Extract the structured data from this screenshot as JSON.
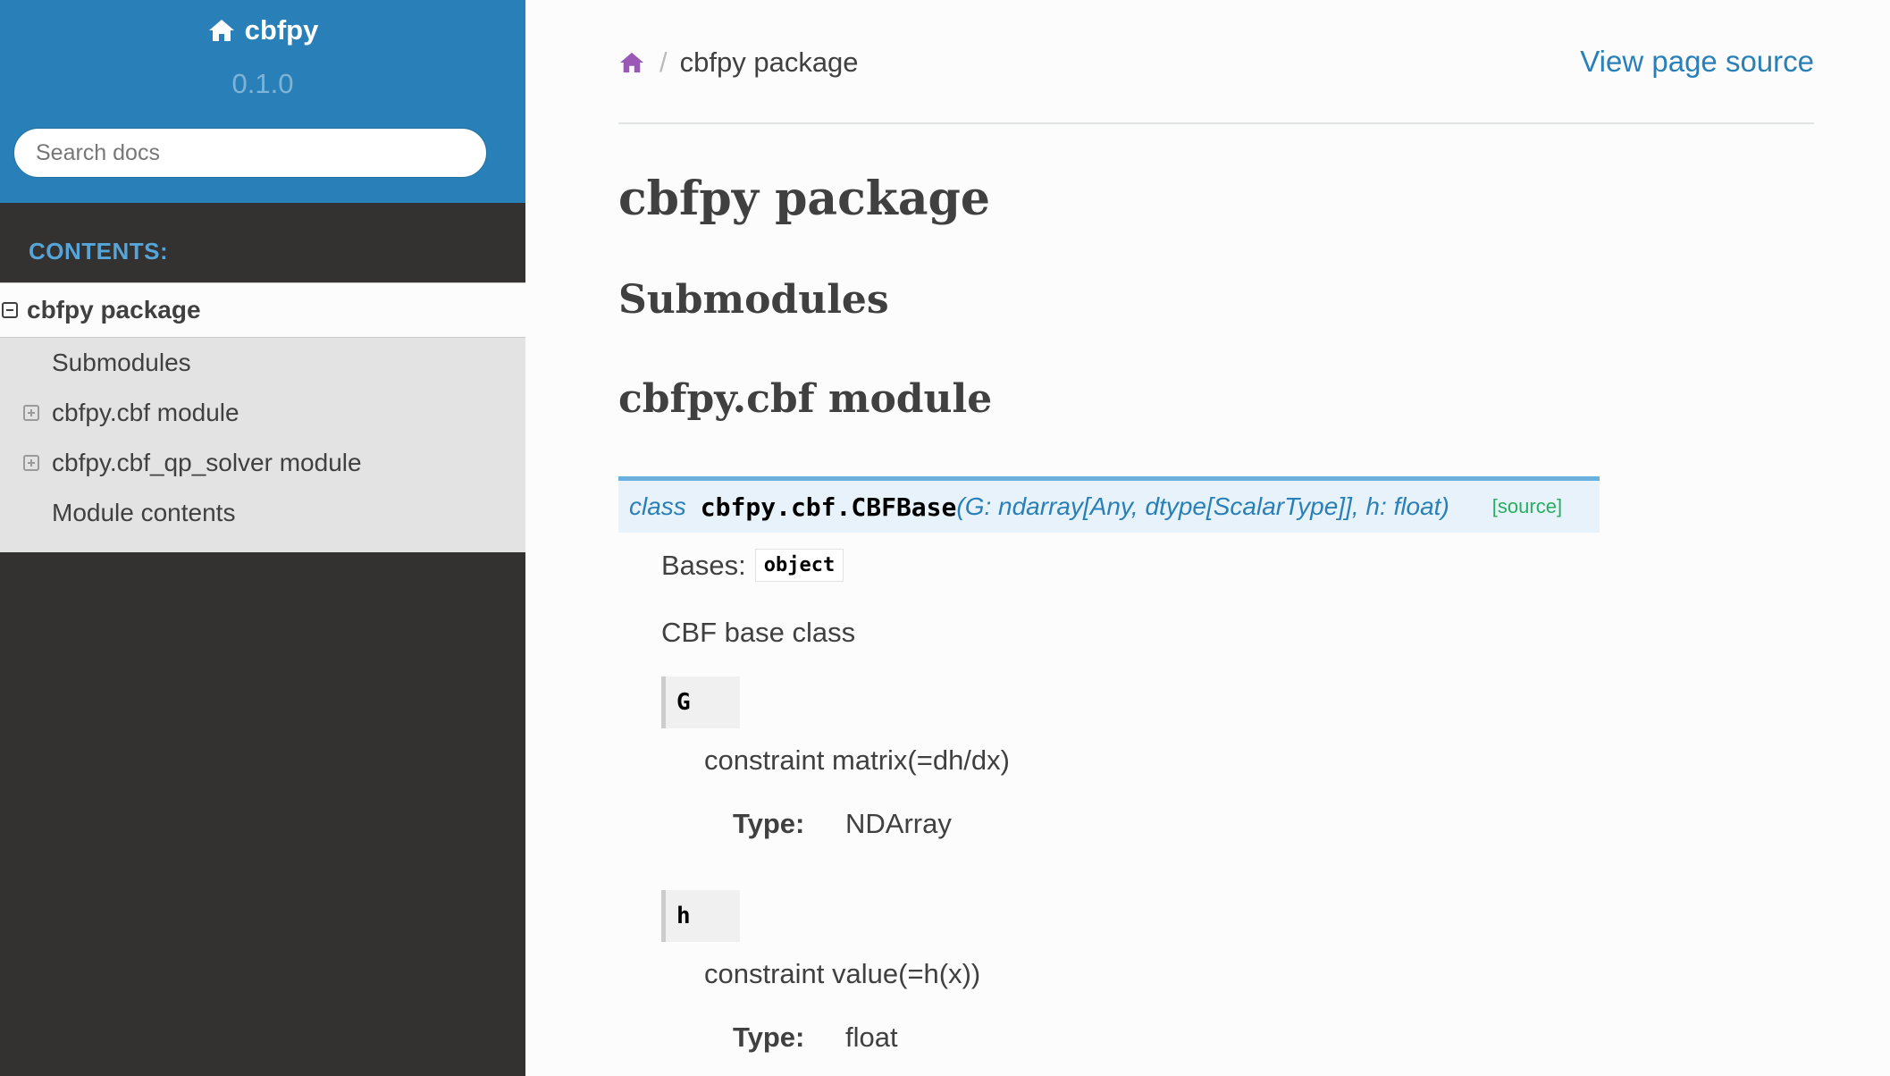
{
  "sidebar": {
    "project": "cbfpy",
    "version": "0.1.0",
    "search_placeholder": "Search docs",
    "caption": "CONTENTS:",
    "current": "cbfpy package",
    "items": [
      {
        "label": "Submodules",
        "expandable": false
      },
      {
        "label": "cbfpy.cbf module",
        "expandable": true
      },
      {
        "label": "cbfpy.cbf_qp_solver module",
        "expandable": true
      },
      {
        "label": "Module contents",
        "expandable": false
      }
    ]
  },
  "breadcrumb": {
    "current": "cbfpy package",
    "separator": "/"
  },
  "view_source": "View page source",
  "page": {
    "title": "cbfpy package",
    "submodules_heading": "Submodules",
    "module_heading": "cbfpy.cbf module"
  },
  "signature": {
    "keyword": "class",
    "name": "cbfpy.cbf.CBFBase",
    "params": "(G: ndarray[Any, dtype[ScalarType]], h: float)",
    "source": "[source]"
  },
  "bases": {
    "label": "Bases:",
    "value": "object"
  },
  "description": "CBF base class",
  "attributes": [
    {
      "name": "G",
      "description": "constraint matrix(=dh/dx)",
      "type_label": "Type:",
      "type": "NDArray"
    },
    {
      "name": "h",
      "description": "constraint value(=h(x))",
      "type_label": "Type:",
      "type": "float"
    }
  ],
  "colors": {
    "sidebar_top": "#2980b9",
    "sidebar_bg": "#343131",
    "link": "#2980b9",
    "caption": "#55a5d9",
    "source_link": "#27ae60"
  }
}
